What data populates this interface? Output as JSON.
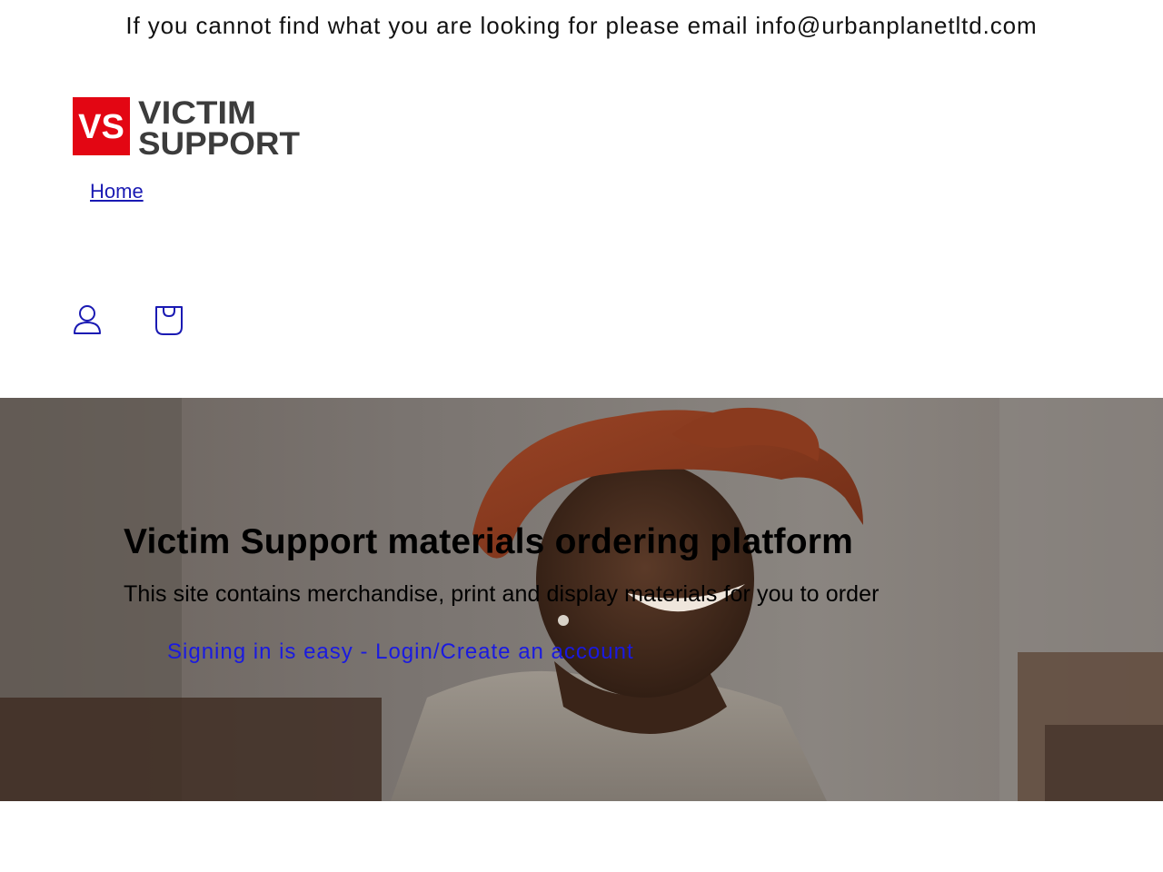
{
  "announcement": {
    "text": "If you cannot find what you are looking for please email info@urbanplanetltd.com"
  },
  "header": {
    "logo": {
      "mark": "VS",
      "line1": "VICTIM",
      "line2": "SUPPORT"
    },
    "nav": {
      "items": [
        {
          "label": "Home"
        }
      ]
    },
    "icons": {
      "account": "account-icon",
      "cart": "cart-icon"
    }
  },
  "hero": {
    "title": "Victim Support materials ordering platform",
    "subtitle": "This site contains merchandise, print and display materials for you to order",
    "link_label": "Signing in is easy - Login/Create an account"
  },
  "colors": {
    "brand_red": "#e30613",
    "brand_grey": "#3c3c3c",
    "link": "#1a1ae0"
  }
}
